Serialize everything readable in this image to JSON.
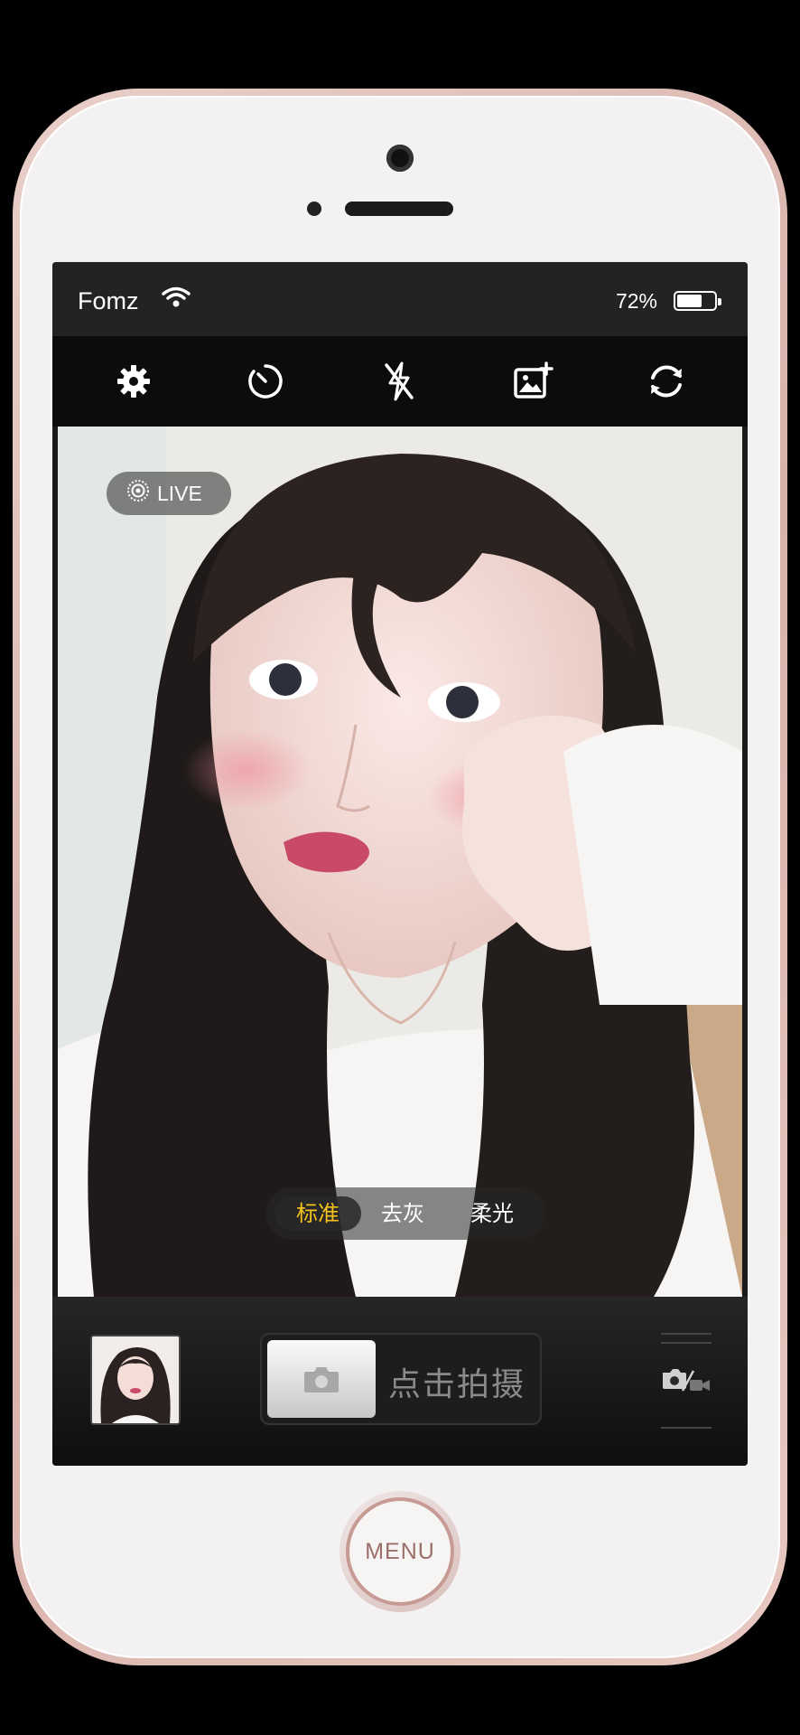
{
  "status_bar": {
    "carrier": "Fomz",
    "battery_percent": "72%",
    "battery_level": 0.72
  },
  "toolbar": {
    "icons": [
      "gear-icon",
      "timer-icon",
      "flash-off-icon",
      "add-photo-icon",
      "switch-camera-icon"
    ]
  },
  "viewfinder": {
    "live_label": "LIVE",
    "filters": [
      {
        "label": "标准",
        "active": true
      },
      {
        "label": "去灰",
        "active": false
      },
      {
        "label": "柔光",
        "active": false
      }
    ]
  },
  "bottom_bar": {
    "shutter_label": "点击拍摄"
  },
  "device": {
    "home_button_label": "MENU"
  },
  "colors": {
    "active_filter": "#f4c21a",
    "phone_frame": "#d8b1aa"
  }
}
